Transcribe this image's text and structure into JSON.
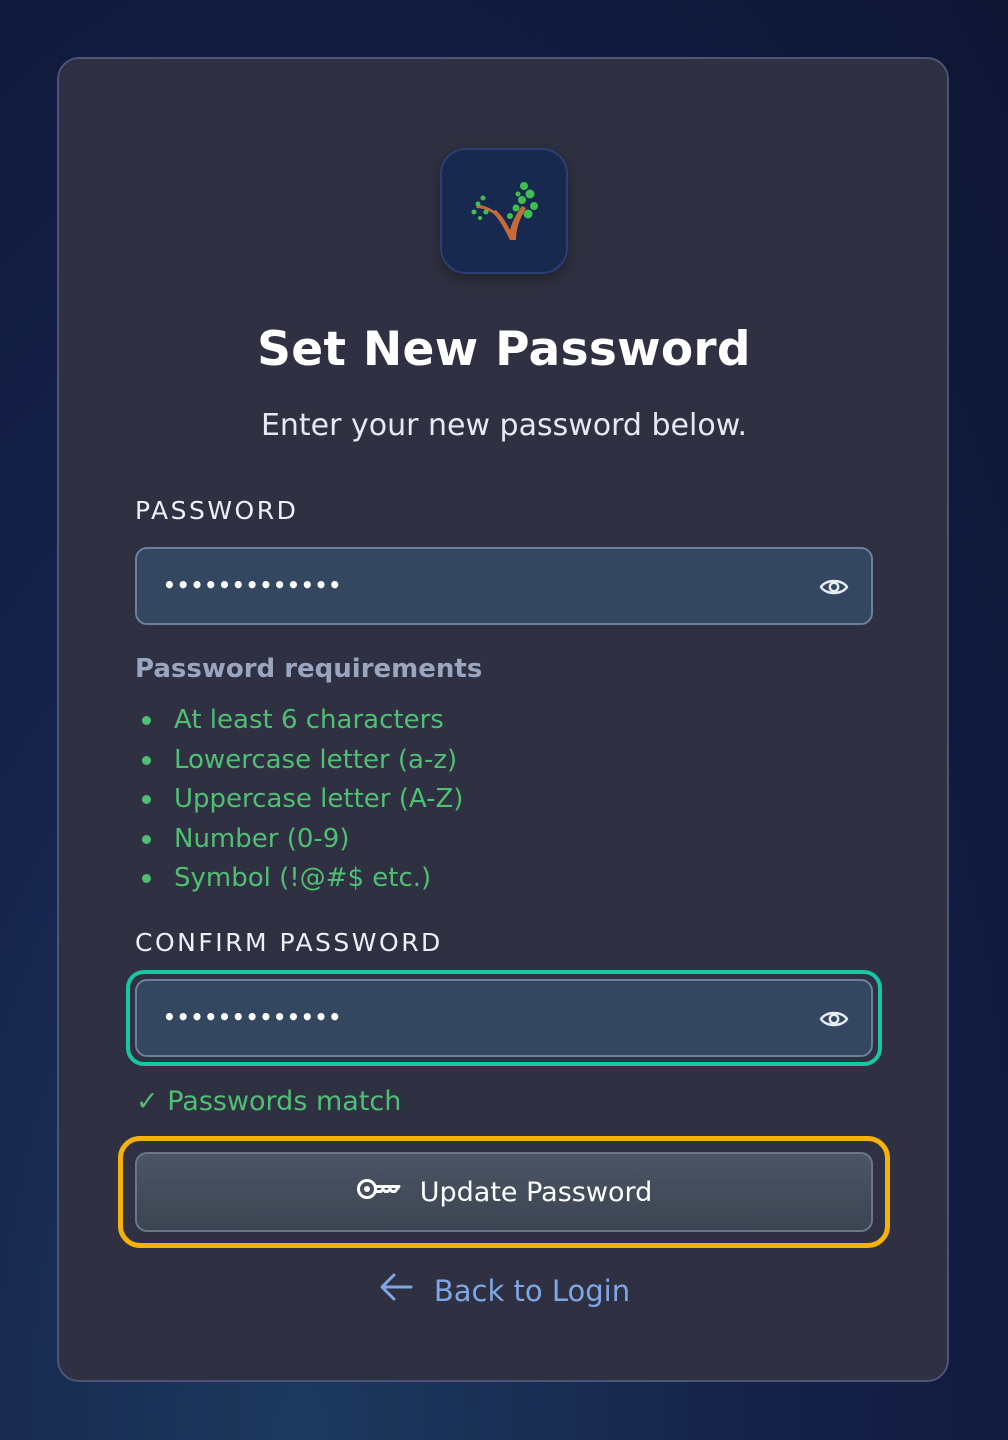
{
  "header": {
    "logo_icon": "tree-logo-icon",
    "title": "Set New Password",
    "subtitle": "Enter your new password below."
  },
  "password": {
    "label": "PASSWORD",
    "value": "•••••••••••••",
    "toggle_icon": "eye-icon"
  },
  "requirements": {
    "title": "Password requirements",
    "items": [
      "At least 6 characters",
      "Lowercase letter (a-z)",
      "Uppercase letter (A-Z)",
      "Number (0-9)",
      "Symbol (!@#$ etc.)"
    ],
    "met_color": "#4fbf73"
  },
  "confirm": {
    "label": "CONFIRM PASSWORD",
    "value": "•••••••••••••",
    "toggle_icon": "eye-icon",
    "status": "✓ Passwords match"
  },
  "submit": {
    "label": "Update Password",
    "icon": "key-icon"
  },
  "back": {
    "label": "Back to Login",
    "icon": "arrow-left-icon"
  },
  "colors": {
    "focus": "#17c6a3",
    "highlight": "#f5b20a",
    "link": "#7fa7e6"
  }
}
